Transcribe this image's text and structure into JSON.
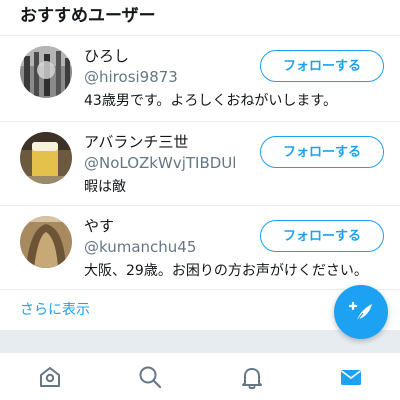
{
  "section": {
    "title": "おすすめユーザー"
  },
  "users": [
    {
      "name": "ひろし",
      "handle": "@hirosi9873",
      "bio": "43歳男です。よろしくおねがいします。",
      "follow_label": "フォローする"
    },
    {
      "name": "アバランチ三世",
      "handle": "@NoLOZkWvjTIBDUl",
      "bio": "暇は敵",
      "follow_label": "フォローする"
    },
    {
      "name": "やす",
      "handle": "@kumanchu45",
      "bio": "大阪、29歳。お困りの方お声がけください。",
      "follow_label": "フォローする"
    }
  ],
  "show_more": "さらに表示",
  "tabs": [
    {
      "icon": "home-icon"
    },
    {
      "icon": "search-icon"
    },
    {
      "icon": "bell-icon"
    },
    {
      "icon": "mail-icon"
    }
  ],
  "compose_icon": "compose-tweet-icon",
  "colors": {
    "accent": "#1da1f2",
    "text": "#14171a",
    "secondary": "#657786",
    "divider": "#e6ecf0"
  }
}
